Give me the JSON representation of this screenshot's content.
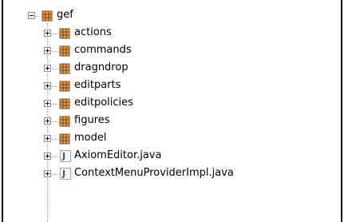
{
  "tree": {
    "root": {
      "label": "gef",
      "icon": "package-icon",
      "expanded": true
    },
    "children": [
      {
        "label": "actions",
        "icon": "package-icon",
        "expander": "plus"
      },
      {
        "label": "commands",
        "icon": "package-icon",
        "expander": "plus"
      },
      {
        "label": "dragndrop",
        "icon": "package-icon",
        "expander": "plus"
      },
      {
        "label": "editparts",
        "icon": "package-icon",
        "expander": "plus"
      },
      {
        "label": "editpolicies",
        "icon": "package-icon",
        "expander": "plus"
      },
      {
        "label": "figures",
        "icon": "package-icon",
        "expander": "plus"
      },
      {
        "label": "model",
        "icon": "package-icon",
        "expander": "plus"
      },
      {
        "label": "AxiomEditor.java",
        "icon": "java-file-icon",
        "expander": "plus"
      },
      {
        "label": "ContextMenuProviderImpl.java",
        "icon": "java-file-icon",
        "expander": "plus"
      }
    ],
    "colors": {
      "package_icon": "#b5651d",
      "java_letter": "#2a57b5",
      "tree_lines": "#a0a0a0"
    }
  }
}
